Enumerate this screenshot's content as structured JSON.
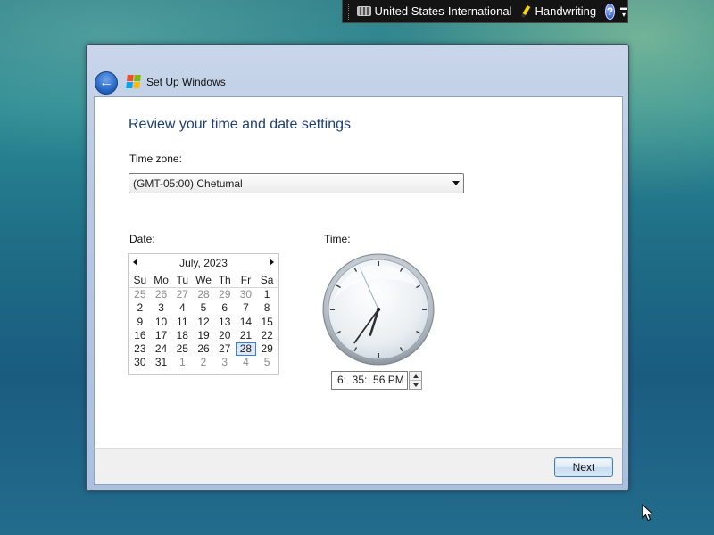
{
  "language_bar": {
    "input_language": "United States-International",
    "handwriting": "Handwriting",
    "help_symbol": "?"
  },
  "window": {
    "title": "Set Up Windows",
    "back_icon": "back-arrow-icon"
  },
  "page": {
    "heading": "Review your time and date settings",
    "time_zone_label": "Time zone:",
    "time_zone_value": "(GMT-05:00) Chetumal",
    "date_label": "Date:",
    "time_label": "Time:"
  },
  "calendar": {
    "month_year": "July, 2023",
    "weekdays": [
      "Su",
      "Mo",
      "Tu",
      "We",
      "Th",
      "Fr",
      "Sa"
    ],
    "weeks": [
      [
        "25",
        "26",
        "27",
        "28",
        "29",
        "30",
        "1"
      ],
      [
        "2",
        "3",
        "4",
        "5",
        "6",
        "7",
        "8"
      ],
      [
        "9",
        "10",
        "11",
        "12",
        "13",
        "14",
        "15"
      ],
      [
        "16",
        "17",
        "18",
        "19",
        "20",
        "21",
        "22"
      ],
      [
        "23",
        "24",
        "25",
        "26",
        "27",
        "28",
        "29"
      ],
      [
        "30",
        "31",
        "1",
        "2",
        "3",
        "4",
        "5"
      ]
    ],
    "selected_day": "28"
  },
  "clock": {
    "time_text": "6:  35:  56 PM",
    "hour": 6,
    "minute": 35,
    "second": 56
  },
  "footer": {
    "next_label": "Next"
  },
  "colors": {
    "heading": "#1f3f73",
    "selection": "#3a7fd6"
  }
}
